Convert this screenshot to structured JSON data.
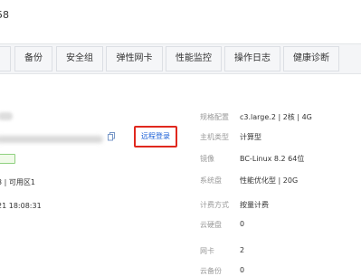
{
  "header": {
    "title_fragment": "58"
  },
  "tabs": [
    {
      "label": ""
    },
    {
      "label": "备份"
    },
    {
      "label": "安全组"
    },
    {
      "label": "弹性网卡"
    },
    {
      "label": "性能监控"
    },
    {
      "label": "操作日志"
    },
    {
      "label": "健康诊断"
    }
  ],
  "left": {
    "remote_login_label": "远程登录",
    "zone_text": "3 | 可用区1",
    "created_text": "21 18:08:31"
  },
  "details": [
    {
      "key": "规格配置",
      "value": "c3.large.2 | 2核 | 4G"
    },
    {
      "key": "主机类型",
      "value": "计算型"
    },
    {
      "key": "镜像",
      "value": "BC-Linux 8.2 64位"
    },
    {
      "key": "系统盘",
      "value": "性能优化型 | 20G"
    },
    {
      "key": "计费方式",
      "value": "按量计费"
    },
    {
      "key": "云硬盘",
      "value": "0"
    },
    {
      "key": "网卡",
      "value": "2"
    },
    {
      "key": "云备份",
      "value": "0"
    }
  ],
  "colors": {
    "accent": "#1a5fd7",
    "highlight_border": "#e0281e",
    "status_green": "#8fd07f"
  }
}
